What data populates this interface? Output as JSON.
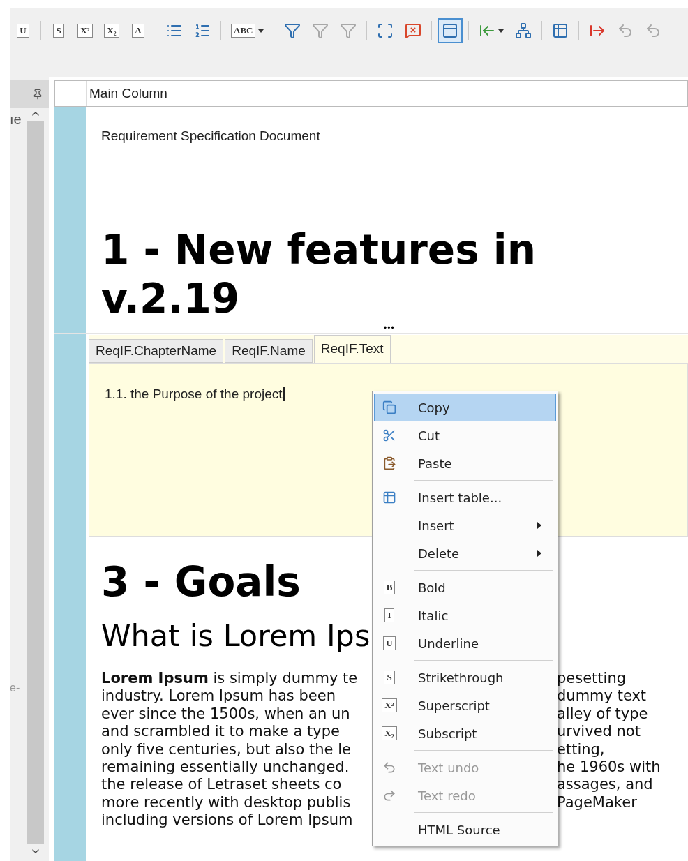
{
  "toolbar": [
    [
      {
        "kind": "glyph",
        "glyph": "U",
        "selected": false,
        "disabled": false
      }
    ],
    [
      {
        "kind": "glyph",
        "glyph": "S",
        "selected": false,
        "disabled": false
      },
      {
        "kind": "glyph",
        "glyph": "X²",
        "selected": false,
        "disabled": false
      },
      {
        "kind": "glyph",
        "glyph": "X₂",
        "selected": false,
        "disabled": false
      },
      {
        "kind": "glyph",
        "glyph": "A",
        "selected": false,
        "disabled": false
      }
    ],
    [
      {
        "kind": "bullets",
        "selected": false,
        "disabled": false
      },
      {
        "kind": "numbers",
        "selected": false,
        "disabled": false
      }
    ],
    [
      {
        "kind": "glyph",
        "glyph": "ABC",
        "selected": false,
        "disabled": false,
        "dropdown": true
      }
    ],
    [
      {
        "kind": "filter",
        "selected": false,
        "disabled": false
      },
      {
        "kind": "filter",
        "selected": false,
        "disabled": true
      },
      {
        "kind": "filter",
        "selected": false,
        "disabled": true
      }
    ],
    [
      {
        "kind": "frame",
        "selected": false,
        "disabled": false
      },
      {
        "kind": "comment",
        "selected": false,
        "disabled": false
      }
    ],
    [
      {
        "kind": "grid",
        "selected": true,
        "disabled": false
      }
    ],
    [
      {
        "kind": "insert",
        "selected": false,
        "disabled": false,
        "dropdown": true
      },
      {
        "kind": "tree",
        "selected": false,
        "disabled": false
      }
    ],
    [
      {
        "kind": "table",
        "selected": false,
        "disabled": false
      }
    ],
    [
      {
        "kind": "export",
        "selected": false,
        "disabled": false
      },
      {
        "kind": "undo",
        "selected": false,
        "disabled": true
      },
      {
        "kind": "undo",
        "selected": false,
        "disabled": true
      }
    ]
  ],
  "side_panel": {
    "texts": [
      "ıe",
      "e-"
    ]
  },
  "grid": {
    "column_header": "Main Column",
    "title": "Requirement Specification Document",
    "heading_1": "1 - New features in v.2.19",
    "more": "•••",
    "tabs": [
      {
        "label": "ReqIF.ChapterName",
        "selected": false
      },
      {
        "label": "ReqIF.Name",
        "selected": false
      },
      {
        "label": "ReqIF.Text",
        "selected": true
      }
    ],
    "editor_text": "1.1. the Purpose of the project",
    "heading_3": "3 - Goals",
    "subheading": "What is Lorem Ips",
    "paragraph_lines": [
      {
        "left": "**Lorem Ipsum** is simply dummy te",
        "right": "pesetting"
      },
      {
        "left": "industry. Lorem Ipsum has been",
        "right": "dummy text"
      },
      {
        "left": "ever since the 1500s, when an un",
        "right": "alley of type"
      },
      {
        "left": "and scrambled it to make a type",
        "right": "urvived not"
      },
      {
        "left": "only five centuries, but also the le",
        "right": "etting,"
      },
      {
        "left": "remaining essentially unchanged.",
        "right": "he 1960s with"
      },
      {
        "left": "the release of Letraset sheets co",
        "right": "assages, and"
      },
      {
        "left": "more recently with desktop publis",
        "right": "PageMaker"
      },
      {
        "left": "including versions of Lorem Ipsum"
      }
    ]
  },
  "context_menu": {
    "groups": [
      [
        {
          "label": "Copy",
          "kind": "copy",
          "selected": true,
          "disabled": false
        },
        {
          "label": "Cut",
          "kind": "cut",
          "selected": false,
          "disabled": false
        },
        {
          "label": "Paste",
          "kind": "paste",
          "selected": false,
          "disabled": false
        }
      ],
      [
        {
          "label": "Insert table...",
          "kind": "table",
          "selected": false,
          "disabled": false
        },
        {
          "label": "Insert",
          "kind": "submenu",
          "selected": false,
          "disabled": false
        },
        {
          "label": "Delete",
          "kind": "submenu",
          "selected": false,
          "disabled": false
        }
      ],
      [
        {
          "label": "Bold",
          "kind": "glyph",
          "glyph": "B",
          "selected": false,
          "disabled": false
        },
        {
          "label": "Italic",
          "kind": "glyph",
          "glyph": "I",
          "selected": false,
          "disabled": false
        },
        {
          "label": "Underline",
          "kind": "glyph",
          "glyph": "U",
          "selected": false,
          "disabled": false
        }
      ],
      [
        {
          "label": "Strikethrough",
          "kind": "glyph",
          "glyph": "S",
          "selected": false,
          "disabled": false
        },
        {
          "label": "Superscript",
          "kind": "glyph",
          "glyph": "X²",
          "selected": false,
          "disabled": false
        },
        {
          "label": "Subscript",
          "kind": "glyph",
          "glyph": "X₂",
          "selected": false,
          "disabled": false
        }
      ],
      [
        {
          "label": "Text undo",
          "kind": "undo",
          "selected": false,
          "disabled": true
        },
        {
          "label": "Text redo",
          "kind": "redo",
          "selected": false,
          "disabled": true
        }
      ],
      [
        {
          "label": "HTML Source",
          "kind": "plain",
          "selected": false,
          "disabled": false
        }
      ]
    ]
  }
}
